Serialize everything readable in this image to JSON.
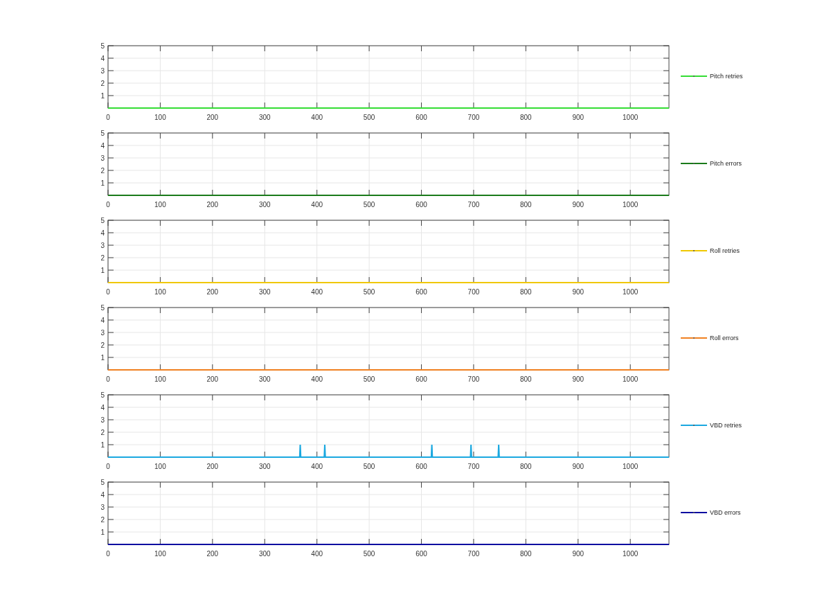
{
  "figure": {
    "panels": [
      {
        "chart_data": {
          "type": "line",
          "grid": true,
          "x": [
            0,
            1074
          ],
          "xlim": [
            0,
            1074
          ],
          "ylim": [
            0,
            5
          ],
          "xticks": [
            0,
            100,
            200,
            300,
            400,
            500,
            600,
            700,
            800,
            900,
            1000
          ],
          "yticks": [
            1,
            2,
            3,
            4,
            5
          ],
          "series": [
            {
              "name": "Pitch retries",
              "color": "#33dd33",
              "values": [
                0,
                0
              ]
            }
          ]
        }
      },
      {
        "chart_data": {
          "type": "line",
          "grid": true,
          "x": [
            0,
            1074
          ],
          "xlim": [
            0,
            1074
          ],
          "ylim": [
            0,
            5
          ],
          "xticks": [
            0,
            100,
            200,
            300,
            400,
            500,
            600,
            700,
            800,
            900,
            1000
          ],
          "yticks": [
            1,
            2,
            3,
            4,
            5
          ],
          "series": [
            {
              "name": "Pitch errors",
              "color": "#1a7a1a",
              "values": [
                0,
                0
              ]
            }
          ]
        }
      },
      {
        "chart_data": {
          "type": "line",
          "grid": true,
          "x": [
            0,
            1074
          ],
          "xlim": [
            0,
            1074
          ],
          "ylim": [
            0,
            5
          ],
          "xticks": [
            0,
            100,
            200,
            300,
            400,
            500,
            600,
            700,
            800,
            900,
            1000
          ],
          "yticks": [
            1,
            2,
            3,
            4,
            5
          ],
          "series": [
            {
              "name": "Roll retries",
              "color": "#f0c800",
              "values": [
                0,
                0
              ]
            }
          ]
        }
      },
      {
        "chart_data": {
          "type": "line",
          "grid": true,
          "x": [
            0,
            1074
          ],
          "xlim": [
            0,
            1074
          ],
          "ylim": [
            0,
            5
          ],
          "xticks": [
            0,
            100,
            200,
            300,
            400,
            500,
            600,
            700,
            800,
            900,
            1000
          ],
          "yticks": [
            1,
            2,
            3,
            4,
            5
          ],
          "series": [
            {
              "name": "Roll errors",
              "color": "#f08020",
              "values": [
                0,
                0
              ]
            }
          ]
        }
      },
      {
        "chart_data": {
          "type": "line",
          "grid": true,
          "x": [
            0,
            367,
            368,
            369,
            414,
            415,
            416,
            619,
            620,
            621,
            694,
            695,
            696,
            747,
            748,
            749,
            1074
          ],
          "xlim": [
            0,
            1074
          ],
          "ylim": [
            0,
            5
          ],
          "xticks": [
            0,
            100,
            200,
            300,
            400,
            500,
            600,
            700,
            800,
            900,
            1000
          ],
          "yticks": [
            1,
            2,
            3,
            4,
            5
          ],
          "series": [
            {
              "name": "VBD retries",
              "color": "#1aa8e0",
              "values": [
                0,
                0,
                1,
                0,
                0,
                1,
                0,
                0,
                1,
                0,
                0,
                1,
                0,
                0,
                1,
                0,
                0
              ]
            }
          ]
        }
      },
      {
        "chart_data": {
          "type": "line",
          "grid": true,
          "x": [
            0,
            1074
          ],
          "xlim": [
            0,
            1074
          ],
          "ylim": [
            0,
            5
          ],
          "xticks": [
            0,
            100,
            200,
            300,
            400,
            500,
            600,
            700,
            800,
            900,
            1000
          ],
          "yticks": [
            1,
            2,
            3,
            4,
            5
          ],
          "series": [
            {
              "name": "VBD errors",
              "color": "#0a0aa0",
              "values": [
                0,
                0
              ]
            }
          ]
        }
      }
    ]
  }
}
